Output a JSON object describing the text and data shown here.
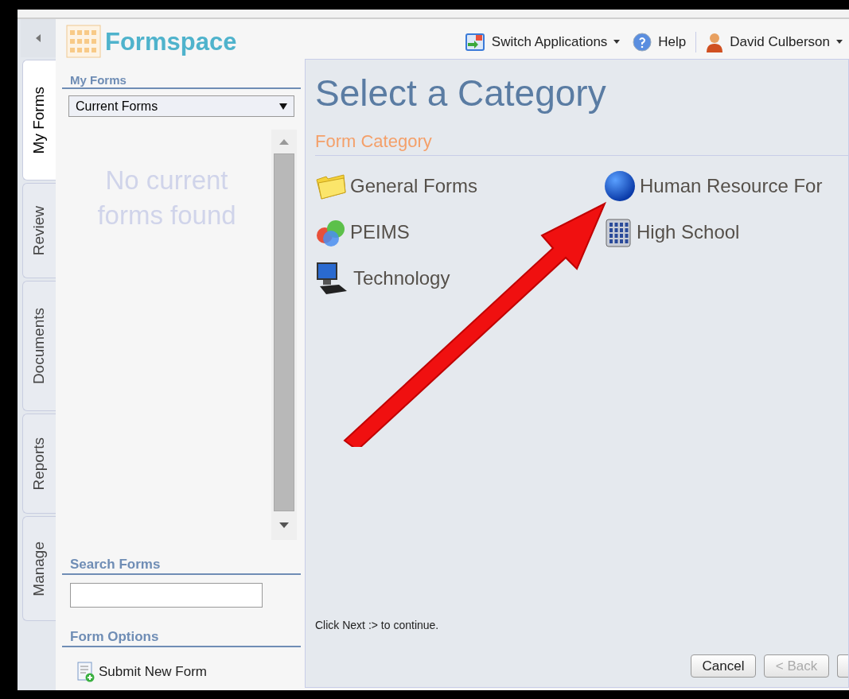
{
  "app": {
    "name": "Formspace"
  },
  "topbar": {
    "switch_label": "Switch Applications",
    "help_label": "Help",
    "user_name": "David Culberson"
  },
  "tabs": [
    {
      "label": "My Forms",
      "selected": true
    },
    {
      "label": "Review",
      "selected": false
    },
    {
      "label": "Documents",
      "selected": false
    },
    {
      "label": "Reports",
      "selected": false
    },
    {
      "label": "Manage",
      "selected": false
    }
  ],
  "sidebar": {
    "my_forms_heading": "My Forms",
    "filter_value": "Current Forms",
    "empty_message": "No current forms found",
    "search_heading": "Search Forms",
    "options_heading": "Form Options",
    "options": [
      "Submit New Form"
    ]
  },
  "main": {
    "title": "Select a Category",
    "section": "Form Category",
    "categories": [
      {
        "label": "General Forms",
        "kind": "folder"
      },
      {
        "label": "Human Resource For",
        "kind": "globe"
      },
      {
        "label": "PEIMS",
        "kind": "bubbles"
      },
      {
        "label": "High School",
        "kind": "building"
      },
      {
        "label": "Technology",
        "kind": "computer"
      }
    ],
    "hint": "Click Next :> to continue.",
    "buttons": [
      {
        "label": "Cancel",
        "disabled": false
      },
      {
        "label": "< Back",
        "disabled": true
      }
    ]
  }
}
